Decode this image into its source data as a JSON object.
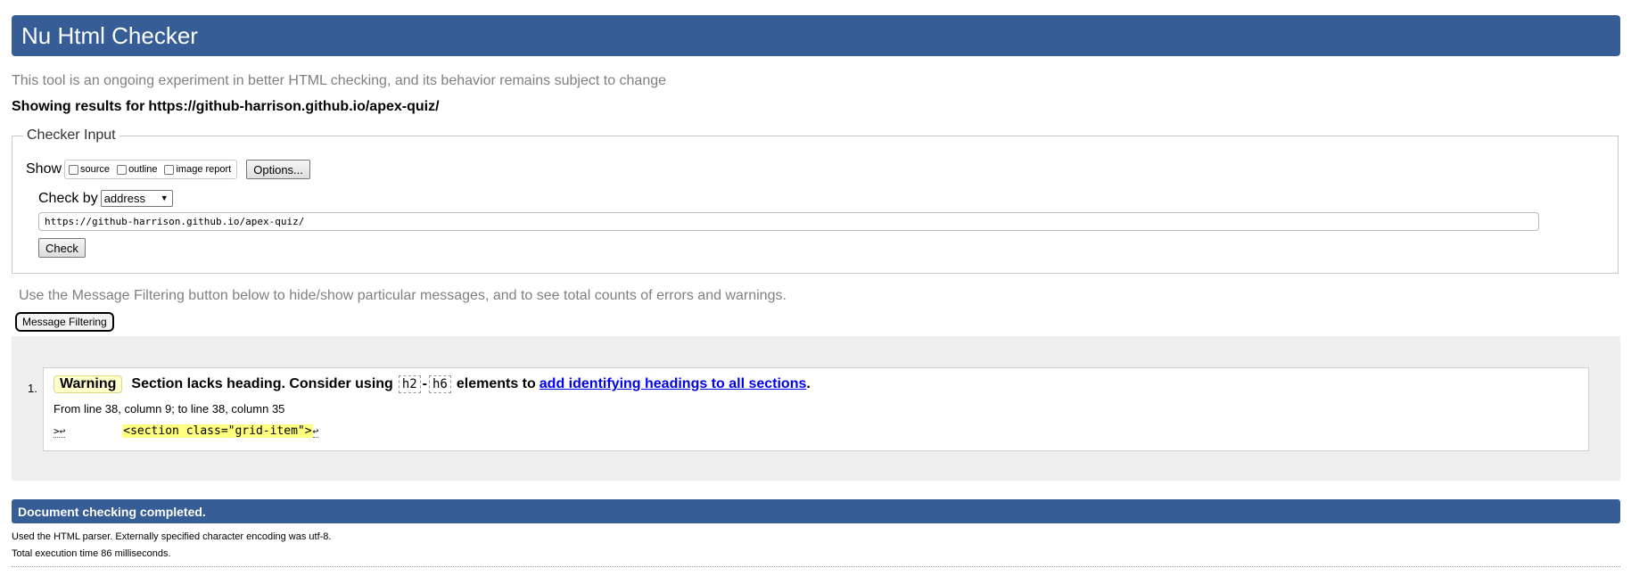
{
  "header": {
    "title": "Nu Html Checker"
  },
  "tagline": "This tool is an ongoing experiment in better HTML checking, and its behavior remains subject to change",
  "results_for": {
    "label": "Showing results for",
    "url": "https://github-harrison.github.io/apex-quiz/"
  },
  "checker_input": {
    "legend": "Checker Input",
    "show_label": "Show",
    "options": [
      {
        "label": "source",
        "checked": false
      },
      {
        "label": "outline",
        "checked": false
      },
      {
        "label": "image report",
        "checked": false
      }
    ],
    "options_button": "Options...",
    "check_by_label": "Check by",
    "check_by_value": "address",
    "url_value": "https://github-harrison.github.io/apex-quiz/",
    "check_button": "Check"
  },
  "filter": {
    "hint": "Use the Message Filtering button below to hide/show particular messages, and to see total counts of errors and warnings.",
    "button": "Message Filtering"
  },
  "messages": [
    {
      "number": "1.",
      "type": "Warning",
      "text_before": "Section lacks heading. Consider using",
      "code_start": "h2",
      "code_sep": "-",
      "code_end": "h6",
      "text_middle": "elements to",
      "link_text": "add identifying headings to all sections",
      "text_after": ".",
      "location": "From line 38, column 9; to line 38, column 35",
      "extract_prefix": ">↩",
      "extract_code": "<section class=\"grid-item\">",
      "extract_suffix": "↩"
    }
  ],
  "footer": {
    "done": "Document checking completed.",
    "parser_note": "Used the HTML parser. Externally specified character encoding was utf-8.",
    "exec_time": "Total execution time 86 milliseconds."
  }
}
